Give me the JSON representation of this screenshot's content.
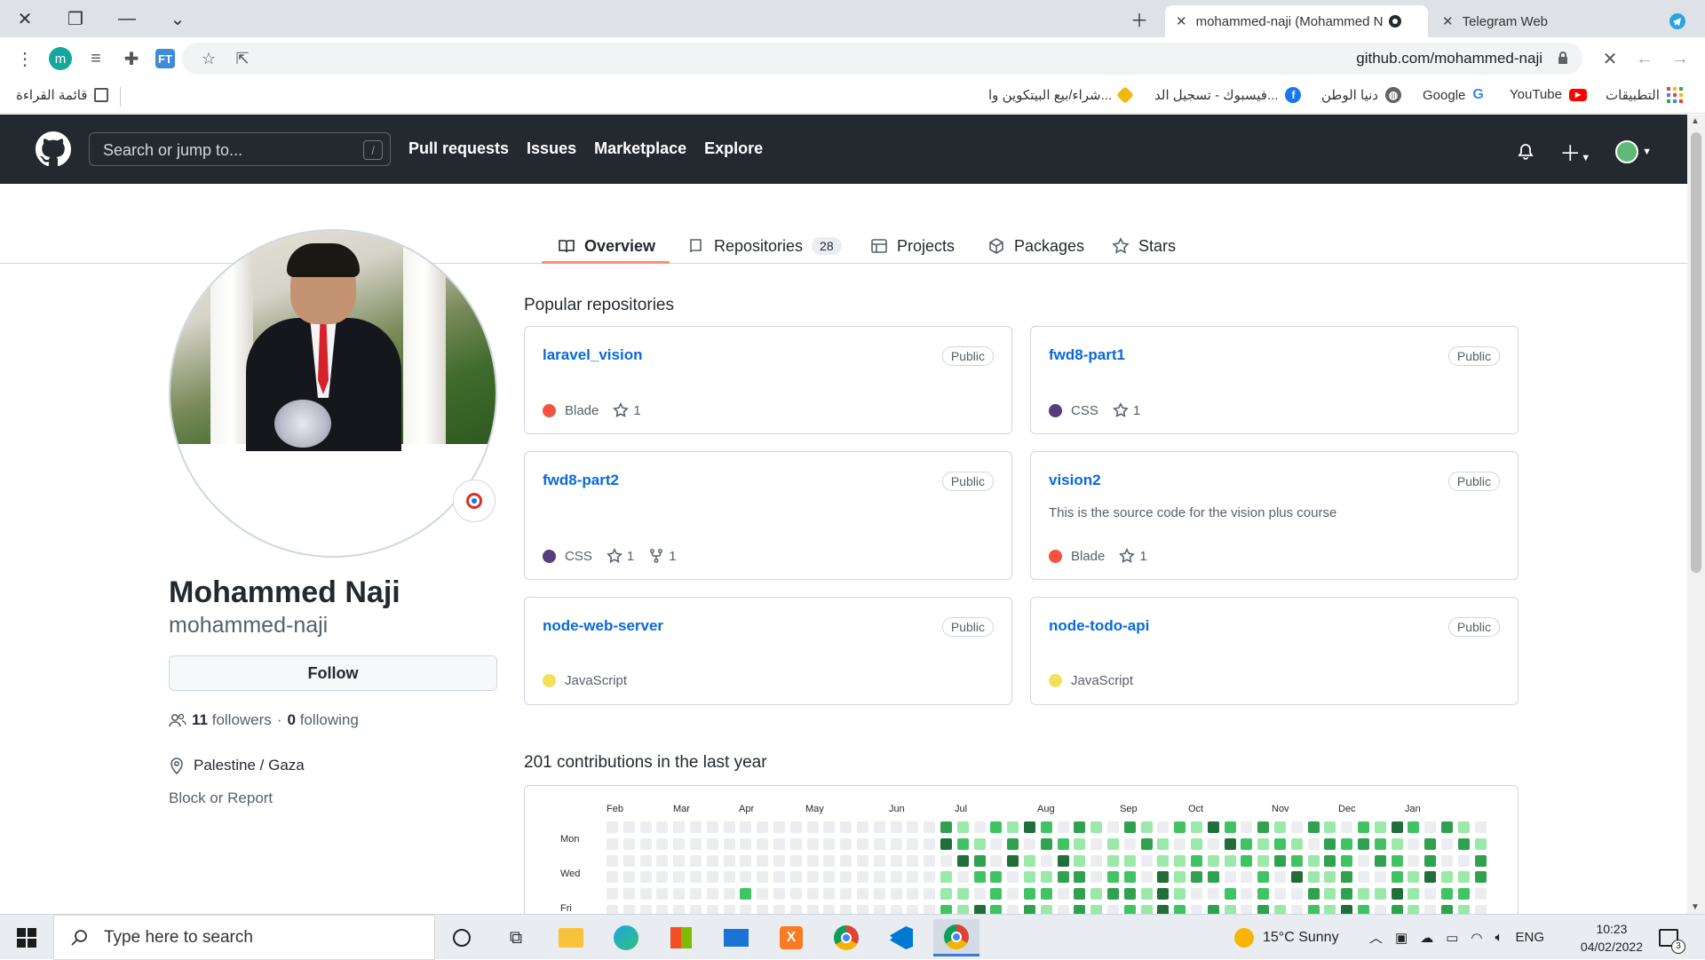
{
  "browser": {
    "tabs": [
      {
        "title": "mohammed-naji (Mohammed N"
      },
      {
        "title": "Telegram Web"
      }
    ],
    "url": "github.com/mohammed-naji",
    "profile_letter": "m",
    "bookmarks": {
      "apps": "التطبيقات",
      "youtube": "YouTube",
      "google": "Google",
      "donia": "دنيا الوطن",
      "facebook": "فيسبوك - تسجيل الد...",
      "binance": "شراء/بيع البيتكوين وا...",
      "reading_list": "قائمة القراءة"
    }
  },
  "github": {
    "search_placeholder": "Search or jump to...",
    "search_key": "/",
    "nav": [
      "Pull requests",
      "Issues",
      "Marketplace",
      "Explore"
    ]
  },
  "profile_tabs": {
    "overview": "Overview",
    "repositories": "Repositories",
    "repositories_count": "28",
    "projects": "Projects",
    "packages": "Packages",
    "stars": "Stars"
  },
  "profile": {
    "name": "Mohammed Naji",
    "login": "mohammed-naji",
    "follow": "Follow",
    "followers_count": "11",
    "followers_label": "followers",
    "separator": "·",
    "following_count": "0",
    "following_label": "following",
    "location": "Palestine / Gaza",
    "block": "Block or Report"
  },
  "popular": {
    "title": "Popular repositories",
    "repos": [
      {
        "name": "laravel_vision",
        "visibility": "Public",
        "description": "",
        "language": "Blade",
        "lang_color": "#f7523f",
        "stars": "1",
        "forks": ""
      },
      {
        "name": "fwd8-part1",
        "visibility": "Public",
        "description": "",
        "language": "CSS",
        "lang_color": "#563d7c",
        "stars": "1",
        "forks": ""
      },
      {
        "name": "fwd8-part2",
        "visibility": "Public",
        "description": "",
        "language": "CSS",
        "lang_color": "#563d7c",
        "stars": "1",
        "forks": "1"
      },
      {
        "name": "vision2",
        "visibility": "Public",
        "description": "This is the source code for the vision plus course",
        "language": "Blade",
        "lang_color": "#f7523f",
        "stars": "1",
        "forks": ""
      },
      {
        "name": "node-web-server",
        "visibility": "Public",
        "description": "",
        "language": "JavaScript",
        "lang_color": "#f1e05a",
        "stars": "",
        "forks": ""
      },
      {
        "name": "node-todo-api",
        "visibility": "Public",
        "description": "",
        "language": "JavaScript",
        "lang_color": "#f1e05a",
        "stars": "",
        "forks": ""
      }
    ]
  },
  "contributions": {
    "title": "201 contributions in the last year",
    "months": [
      "Feb",
      "Mar",
      "Apr",
      "May",
      "Jun",
      "Jul",
      "Aug",
      "Sep",
      "Oct",
      "Nov",
      "Dec",
      "Jan"
    ],
    "days": [
      "Mon",
      "Wed",
      "Fri"
    ],
    "colors": [
      "#ebedf0",
      "#9be9a8",
      "#40c463",
      "#30a14e",
      "#216e39"
    ]
  },
  "taskbar": {
    "search_placeholder": "Type here to search",
    "weather": "15°C  Sunny",
    "lang": "ENG",
    "time": "10:23",
    "date": "04/02/2022",
    "notifications": "3"
  }
}
